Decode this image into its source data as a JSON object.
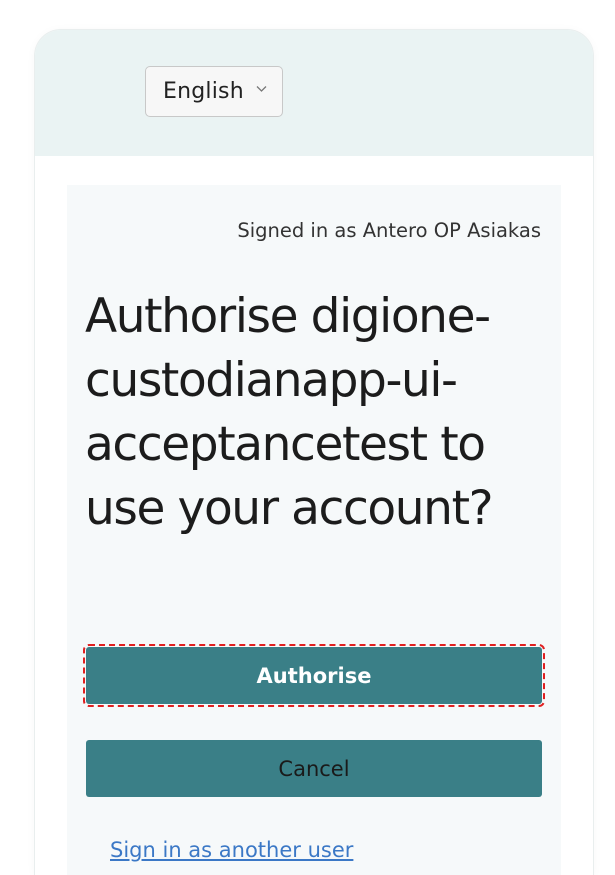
{
  "language_selector": {
    "selected": "English",
    "icon": "chevron-down-icon"
  },
  "consent": {
    "signed_in_text": "Signed in as Antero OP Asiakas",
    "title": "Authorise digione-custodianapp-ui-acceptancetest to use your account?",
    "authorise_label": "Authorise",
    "cancel_label": "Cancel",
    "switch_user_link": "Sign in as another user"
  },
  "colors": {
    "header_background": "#eaf3f3",
    "panel_background": "#f6f9fa",
    "button_primary": "#3a7f87",
    "link": "#3b78c6",
    "highlight_outline": "#e02020"
  }
}
